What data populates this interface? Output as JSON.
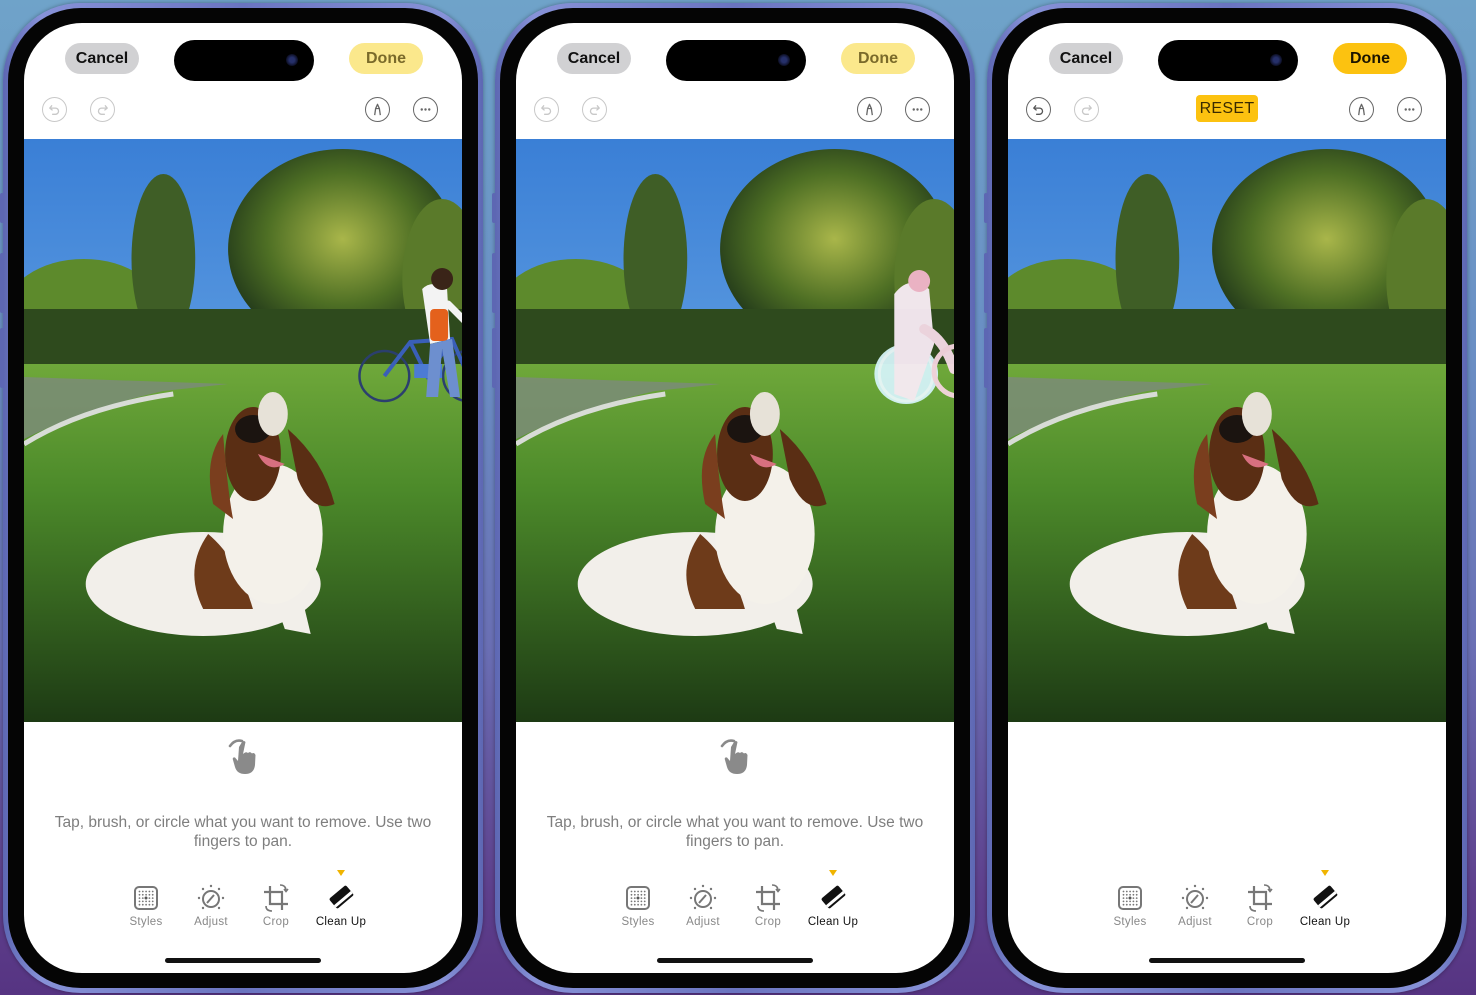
{
  "phones": [
    {
      "state": "original",
      "cancel_label": "Cancel",
      "done_label": "Done",
      "done_active": false,
      "reset_label": null,
      "undo_enabled": false,
      "redo_enabled": false,
      "photo_variant": "with-cyclist",
      "hint_text": "Tap, brush, or circle what you want to remove. Use two fingers to pan.",
      "toolbar": [
        {
          "label": "Styles",
          "icon": "styles-grid-icon"
        },
        {
          "label": "Adjust",
          "icon": "adjust-dial-icon"
        },
        {
          "label": "Crop",
          "icon": "crop-rotate-icon"
        },
        {
          "label": "Clean Up",
          "icon": "eraser-icon",
          "selected": true
        }
      ]
    },
    {
      "state": "selecting",
      "cancel_label": "Cancel",
      "done_label": "Done",
      "done_active": false,
      "reset_label": null,
      "undo_enabled": false,
      "redo_enabled": false,
      "photo_variant": "cyclist-highlighted",
      "hint_text": "Tap, brush, or circle what you want to remove. Use two fingers to pan.",
      "toolbar": [
        {
          "label": "Styles",
          "icon": "styles-grid-icon"
        },
        {
          "label": "Adjust",
          "icon": "adjust-dial-icon"
        },
        {
          "label": "Crop",
          "icon": "crop-rotate-icon"
        },
        {
          "label": "Clean Up",
          "icon": "eraser-icon",
          "selected": true
        }
      ]
    },
    {
      "state": "cleaned",
      "cancel_label": "Cancel",
      "done_label": "Done",
      "done_active": true,
      "reset_label": "RESET",
      "undo_enabled": true,
      "redo_enabled": false,
      "photo_variant": "cyclist-removed",
      "hint_text": "",
      "toolbar": [
        {
          "label": "Styles",
          "icon": "styles-grid-icon"
        },
        {
          "label": "Adjust",
          "icon": "adjust-dial-icon"
        },
        {
          "label": "Crop",
          "icon": "crop-rotate-icon"
        },
        {
          "label": "Clean Up",
          "icon": "eraser-icon",
          "selected": true
        }
      ]
    }
  ],
  "colors": {
    "accent_yellow": "#fcc210",
    "done_inactive": "#fbe88c",
    "cancel_bg": "#d1d1d3",
    "hint_text": "#7e7e7e"
  }
}
